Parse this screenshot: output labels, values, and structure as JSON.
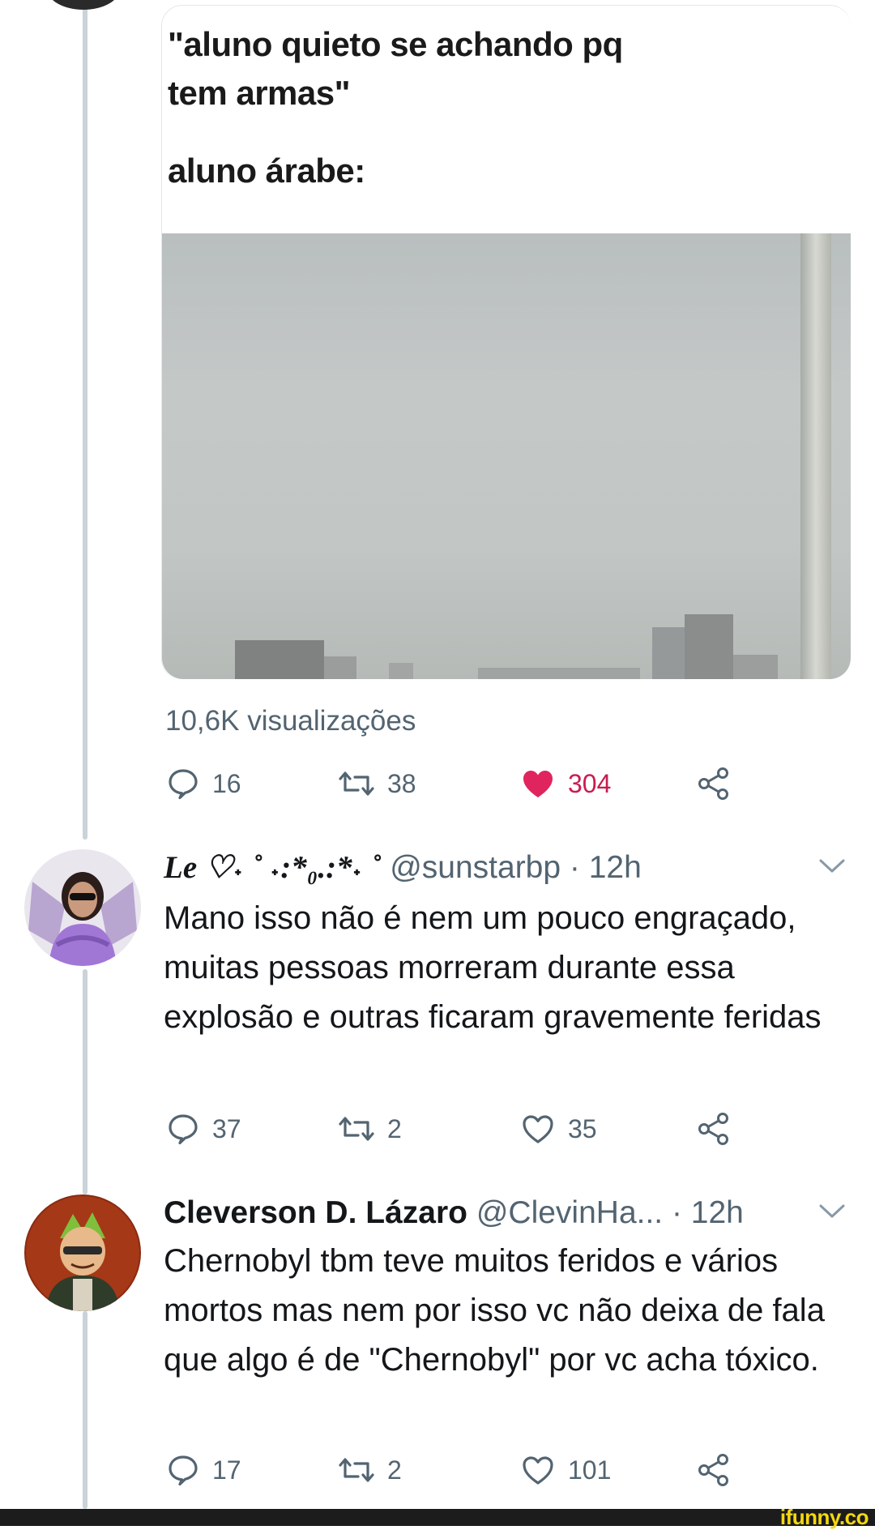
{
  "tweet": {
    "meme_line1": "\"aluno quieto se achando pq",
    "meme_line2": "tem armas\"",
    "meme_line3": "aluno árabe:",
    "views": "10,6K visualizações",
    "replies": "16",
    "retweets": "38",
    "likes": "304",
    "liked": true
  },
  "replies": [
    {
      "display_name": "Le ♡˖ ˚ ˖:*₀.:*˖ ˚",
      "handle": "@sunstarbp",
      "time": "· 12h",
      "body": "Mano isso não é nem um pouco engraçado, muitas pessoas morreram durante essa explosão e outras ficaram gravemente feridas",
      "replies": "37",
      "retweets": "2",
      "likes": "35"
    },
    {
      "display_name": "Cleverson D. Lázaro",
      "handle": "@ClevinHa...",
      "time": "· 12h",
      "body": "Chernobyl tbm teve muitos feridos e vários mortos mas nem por isso vc não deixa de fala que algo é de \"Chernobyl\" por vc acha tóxico.",
      "replies": "17",
      "retweets": "2",
      "likes": "101"
    }
  ],
  "watermark": "ifunny.co",
  "colors": {
    "like_active": "#e0245e",
    "muted": "#536471",
    "thread_line": "#c9d3d8"
  },
  "icons": [
    "reply-icon",
    "retweet-icon",
    "heart-icon",
    "share-icon",
    "chevron-down-icon"
  ]
}
